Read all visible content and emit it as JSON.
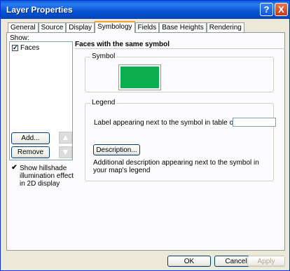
{
  "window": {
    "title": "Layer Properties"
  },
  "titlebar_buttons": {
    "help": "?",
    "close": "X"
  },
  "tabs": [
    {
      "label": "General"
    },
    {
      "label": "Source"
    },
    {
      "label": "Display"
    },
    {
      "label": "Symbology",
      "active": true
    },
    {
      "label": "Fields"
    },
    {
      "label": "Base Heights"
    },
    {
      "label": "Rendering"
    }
  ],
  "show_panel": {
    "label": "Show:",
    "items": [
      {
        "label": "Faces",
        "checked": true
      }
    ],
    "add_label": "Add...",
    "remove_label": "Remove",
    "up_icon": "up-arrow-icon",
    "down_icon": "down-arrow-icon",
    "hillshade_label": "Show hillshade illumination effect in 2D display",
    "hillshade_checked": true
  },
  "renderer": {
    "heading": "Faces with the same symbol",
    "symbol_group": "Symbol",
    "symbol_color": "#0aae4e",
    "legend_group": "Legend",
    "label_prompt": "Label appearing next to the symbol in table of contents:",
    "label_value": "",
    "description_button": "Description...",
    "description_help": "Additional description appearing next to the symbol in your map's legend"
  },
  "footer": {
    "ok": "OK",
    "cancel": "Cancel",
    "apply": "Apply"
  }
}
